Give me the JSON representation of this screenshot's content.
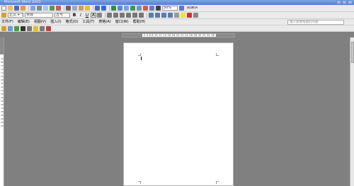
{
  "window": {
    "title": "Microsoft Word 2003",
    "controls": [
      "minimize",
      "maximize",
      "close"
    ]
  },
  "toolbar_standard": {
    "zoom": "50%",
    "reading_label": "阅读(R)",
    "icons": [
      "new-icon",
      "open-icon",
      "save-icon",
      "permission-icon",
      "email-icon",
      "print-icon",
      "print-preview-icon",
      "spelling-icon",
      "research-icon",
      "cut-icon",
      "copy-icon",
      "paste-icon",
      "format-painter-icon",
      "undo-icon",
      "redo-icon",
      "hyperlink-icon",
      "tables-icon",
      "insert-table-icon",
      "excel-icon",
      "columns-icon",
      "drawing-icon",
      "document-map-icon",
      "show-hide-icon"
    ]
  },
  "toolbar_formatting": {
    "style": "正文 + 宋",
    "font": "宋体",
    "size": "五号",
    "bold": "B",
    "italic": "I",
    "underline": "U",
    "border": "A"
  },
  "menu": {
    "items": [
      "文件(F)",
      "编辑(E)",
      "视图(V)",
      "插入(I)",
      "格式(O)",
      "工具(T)",
      "表格(A)",
      "窗口(W)",
      "帮助(H)"
    ],
    "help_placeholder": "键入需要帮助的问题"
  },
  "ruler": {
    "ticks": "2 4 6 8 10 12 14 16 18 20 22 24 26 28 30 32 34 36 38",
    "vticks": "2468101214161820222426283032343638404244"
  },
  "colors": {
    "titlebar": "#4f7fcf",
    "workspace": "#808080",
    "page": "#ffffff"
  }
}
